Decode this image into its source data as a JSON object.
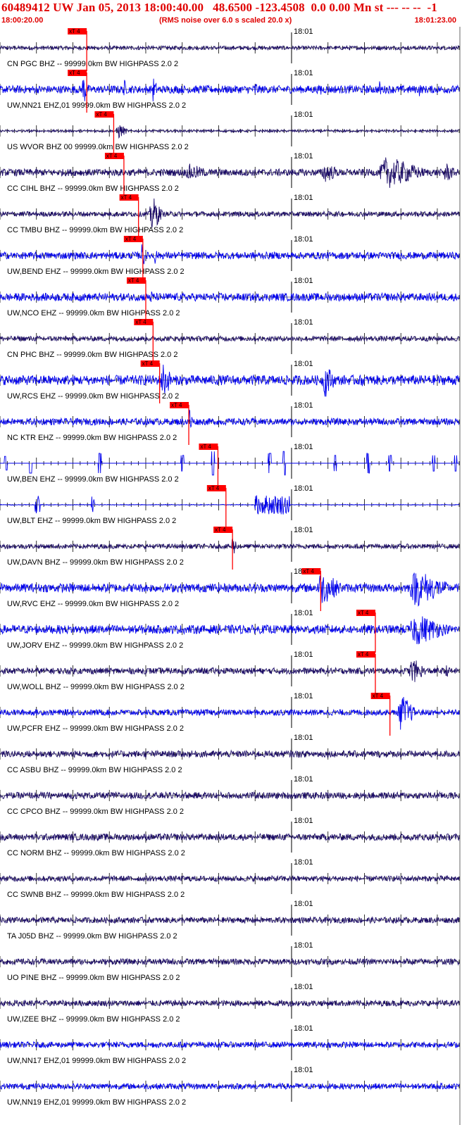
{
  "header": {
    "title": "60489412 UW Jan 05, 2013 18:00:40.00   48.6500 -123.4508  0.0 0.00 Mn st --- -- --  -1",
    "start_time": "18:00:20.00",
    "note": "(RMS noise over 6.0 s scaled 20.0 x)",
    "end_time": "18:01:23.00"
  },
  "colors": {
    "text": "#e00000",
    "pick": "#ff0000",
    "trace_dark": "#1a0a66",
    "trace_blue": "#0000ee",
    "axis": "#000000"
  },
  "chart_data": {
    "type": "line",
    "x_range_seconds": [
      0,
      63
    ],
    "minute_tick_label": "18:01",
    "minute_tick_seconds": 40,
    "pick_label": "xT 4",
    "traces": [
      {
        "label": "CN PGC BHZ -- 99999.0km BW  HIGHPASS  2.0  2",
        "color": "dark",
        "pick": 11.9,
        "amp": 0.1,
        "style": "noise",
        "bursts": []
      },
      {
        "label": "UW,NN21 EHZ,01 99999.0km BW  HIGHPASS  2.0  2",
        "color": "blue",
        "pick": 11.9,
        "amp": 0.2,
        "style": "noise",
        "bursts": [
          [
            11.4,
            1.0,
            0.9
          ],
          [
            17.0,
            0.6,
            0.6
          ],
          [
            21.0,
            0.8,
            0.7
          ],
          [
            35.0,
            0.8,
            0.5
          ],
          [
            44.0,
            0.8,
            0.4
          ],
          [
            52.0,
            0.7,
            0.5
          ],
          [
            57.5,
            0.6,
            0.4
          ]
        ]
      },
      {
        "label": "US WVOR BHZ 00 99999.0km BW  HIGHPASS  2.0  2",
        "color": "dark",
        "pick": 15.6,
        "amp": 0.06,
        "style": "noise",
        "bursts": [
          [
            16.2,
            1.6,
            0.45
          ]
        ]
      },
      {
        "label": "CC CIHL BHZ -- 99999.0km BW  HIGHPASS  2.0  2",
        "color": "dark",
        "pick": 17.0,
        "amp": 0.18,
        "style": "noise",
        "bursts": [
          [
            26.0,
            4.0,
            0.45
          ],
          [
            44.5,
            3.0,
            0.55
          ],
          [
            53.0,
            7.0,
            0.85
          ],
          [
            61.0,
            2.0,
            0.6
          ]
        ]
      },
      {
        "label": "CC TMBU BHZ -- 99999.0km BW  HIGHPASS  2.0  2",
        "color": "dark",
        "pick": 19.0,
        "amp": 0.13,
        "style": "noise",
        "bursts": [
          [
            20.8,
            1.8,
            1.0
          ]
        ]
      },
      {
        "label": "UW,BEND EHZ -- 99999.0km BW  HIGHPASS  2.0  2",
        "color": "blue",
        "pick": 19.6,
        "amp": 0.18,
        "style": "noise",
        "bursts": [
          [
            19.5,
            0.5,
            1.0
          ],
          [
            21.2,
            0.7,
            0.5
          ]
        ]
      },
      {
        "label": "UW,NCO EHZ -- 99999.0km BW  HIGHPASS  2.0  2",
        "color": "blue",
        "pick": 20.0,
        "amp": 0.2,
        "style": "noise",
        "bursts": [
          [
            20.5,
            1.5,
            0.4
          ]
        ]
      },
      {
        "label": "CN PHC BHZ -- 99999.0km BW  HIGHPASS  2.0  2",
        "color": "dark",
        "pick": 21.0,
        "amp": 0.13,
        "style": "noise",
        "bursts": []
      },
      {
        "label": "UW,RCS EHZ -- 99999.0km BW  HIGHPASS  2.0  2",
        "color": "blue",
        "pick": 21.9,
        "amp": 0.25,
        "style": "noise",
        "bursts": [
          [
            22.3,
            1.8,
            1.0
          ],
          [
            44.5,
            2.0,
            0.95
          ],
          [
            49.5,
            1.5,
            0.35
          ]
        ]
      },
      {
        "label": "NC KTR EHZ -- 99999.0km BW  HIGHPASS  2.0  2",
        "color": "blue",
        "pick": 25.9,
        "amp": 0.17,
        "style": "noise",
        "bursts": [
          [
            26.0,
            0.6,
            1.0
          ]
        ]
      },
      {
        "label": "UW,BEN EHZ -- 99999.0km BW  HIGHPASS  2.0  2",
        "color": "blue",
        "pick": 29.9,
        "amp": 0.0,
        "style": "spikes",
        "bursts": [
          [
            0.8,
            0.2,
            0.35
          ],
          [
            4.2,
            0.2,
            0.5
          ],
          [
            13.7,
            0.2,
            0.5
          ],
          [
            25.0,
            0.2,
            0.4
          ],
          [
            29.2,
            0.2,
            0.6
          ],
          [
            37.0,
            0.2,
            0.5
          ],
          [
            39.0,
            0.2,
            0.6
          ],
          [
            46.0,
            0.2,
            0.4
          ],
          [
            50.5,
            0.2,
            0.5
          ],
          [
            53.5,
            0.2,
            0.4
          ],
          [
            59.5,
            0.2,
            0.4
          ],
          [
            62.5,
            0.2,
            0.4
          ]
        ]
      },
      {
        "label": "UW,BLT EHZ -- 99999.0km BW  HIGHPASS  2.0  2",
        "color": "blue",
        "pick": 31.0,
        "amp": 0.0,
        "style": "blocks",
        "bursts": [
          [
            4.8,
            0.7,
            0.45
          ],
          [
            12.5,
            0.5,
            0.5
          ],
          [
            35.0,
            4.8,
            0.5
          ]
        ]
      },
      {
        "label": "UW,DAVN BHZ -- 99999.0km BW  HIGHPASS  2.0  2",
        "color": "dark",
        "pick": 31.9,
        "amp": 0.12,
        "style": "noise",
        "bursts": [
          [
            31.8,
            1.0,
            0.7
          ]
        ]
      },
      {
        "label": "UW,RVC EHZ -- 99999.0km BW  HIGHPASS  2.0  2",
        "color": "blue",
        "pick": 44.0,
        "amp": 0.22,
        "style": "noise",
        "bursts": [
          [
            44.0,
            4.0,
            0.9
          ],
          [
            57.0,
            6.0,
            1.0
          ]
        ]
      },
      {
        "label": "UW,JORV EHZ -- 99999.0km BW  HIGHPASS  2.0  2",
        "color": "blue",
        "pick": 51.5,
        "amp": 0.22,
        "style": "noise",
        "bursts": [
          [
            57.0,
            6.0,
            0.85
          ]
        ]
      },
      {
        "label": "UW,WOLL BHZ -- 99999.0km BW  HIGHPASS  2.0  2",
        "color": "dark",
        "pick": 51.5,
        "amp": 0.16,
        "style": "noise",
        "bursts": [
          [
            56.5,
            2.5,
            0.7
          ],
          [
            61.0,
            1.2,
            0.4
          ]
        ]
      },
      {
        "label": "UW,PCFR EHZ -- 99999.0km BW  HIGHPASS  2.0  2",
        "color": "blue",
        "pick": 53.5,
        "amp": 0.15,
        "style": "noise",
        "bursts": [
          [
            55.0,
            2.5,
            1.0
          ]
        ]
      },
      {
        "label": "CC ASBU BHZ -- 99999.0km BW  HIGHPASS  2.0  2",
        "color": "dark",
        "pick": null,
        "amp": 0.17,
        "style": "noise",
        "bursts": []
      },
      {
        "label": "CC CPCO BHZ -- 99999.0km BW  HIGHPASS  2.0  2",
        "color": "dark",
        "pick": null,
        "amp": 0.17,
        "style": "noise",
        "bursts": []
      },
      {
        "label": "CC NORM BHZ -- 99999.0km BW  HIGHPASS  2.0  2",
        "color": "dark",
        "pick": null,
        "amp": 0.17,
        "style": "noise",
        "bursts": []
      },
      {
        "label": "CC SWNB BHZ -- 99999.0km BW  HIGHPASS  2.0  2",
        "color": "dark",
        "pick": null,
        "amp": 0.14,
        "style": "noise",
        "bursts": []
      },
      {
        "label": "TA J05D BHZ -- 99999.0km BW  HIGHPASS  2.0  2",
        "color": "dark",
        "pick": null,
        "amp": 0.15,
        "style": "noise",
        "bursts": []
      },
      {
        "label": "UO PINE BHZ -- 99999.0km BW  HIGHPASS  2.0  2",
        "color": "dark",
        "pick": null,
        "amp": 0.15,
        "style": "noise",
        "bursts": []
      },
      {
        "label": "UW,IZEE BHZ -- 99999.0km BW  HIGHPASS  2.0  2",
        "color": "dark",
        "pick": null,
        "amp": 0.15,
        "style": "noise",
        "bursts": []
      },
      {
        "label": "UW,NN17 EHZ,01 99999.0km BW  HIGHPASS  2.0  2",
        "color": "blue",
        "pick": null,
        "amp": 0.15,
        "style": "noise",
        "bursts": []
      },
      {
        "label": "UW,NN19 EHZ,01 99999.0km BW  HIGHPASS  2.0  2",
        "color": "blue",
        "pick": null,
        "amp": 0.15,
        "style": "noise",
        "bursts": []
      }
    ]
  }
}
